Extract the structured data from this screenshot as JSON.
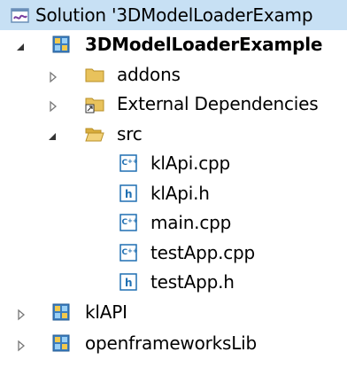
{
  "tree": {
    "solution": {
      "label": "Solution '3DModelLoaderExamp",
      "icon": "solution-icon"
    },
    "project": {
      "label": "3DModelLoaderExample",
      "icon": "project-icon",
      "expanded": true
    },
    "addons": {
      "label": "addons",
      "icon": "folder-icon",
      "expanded": false
    },
    "external": {
      "label": "External Dependencies",
      "icon": "external-deps-folder-icon",
      "expanded": false
    },
    "src": {
      "label": "src",
      "icon": "open-folder-icon",
      "expanded": true
    },
    "files": [
      {
        "label": "klApi.cpp",
        "icon": "cpp-file-icon"
      },
      {
        "label": "klApi.h",
        "icon": "header-file-icon"
      },
      {
        "label": "main.cpp",
        "icon": "cpp-file-icon"
      },
      {
        "label": "testApp.cpp",
        "icon": "cpp-file-icon"
      },
      {
        "label": "testApp.h",
        "icon": "header-file-icon"
      }
    ],
    "klapi_project": {
      "label": "klAPI",
      "icon": "project-icon",
      "expanded": false
    },
    "of_project": {
      "label": "openframeworksLib",
      "icon": "project-icon",
      "expanded": false
    }
  },
  "colors": {
    "selection": "#c7e0f4",
    "folder": "#e8c25c",
    "cpp_icon": "#1f6fb2",
    "header_icon": "#1f6fb2"
  }
}
